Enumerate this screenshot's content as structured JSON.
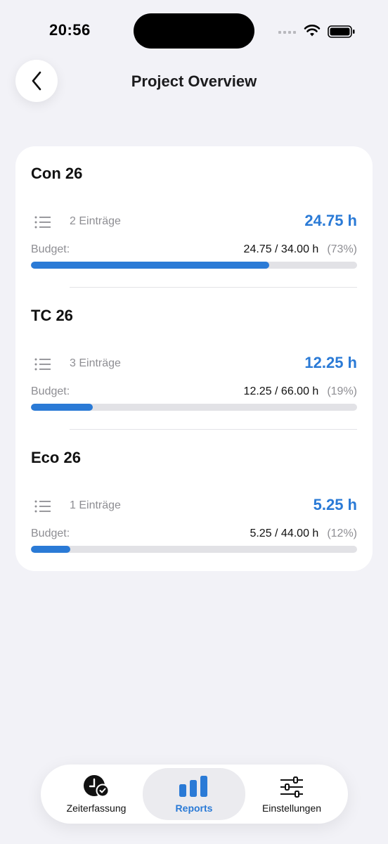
{
  "status": {
    "time": "20:56"
  },
  "header": {
    "title": "Project Overview",
    "back_icon": "chevron-left-icon"
  },
  "colors": {
    "accent": "#2a7ad6",
    "background": "#f2f2f7",
    "track": "#e2e2e6"
  },
  "projects": [
    {
      "name": "Con 26",
      "entries": "2 Einträge",
      "hours": "24.75 h",
      "budget_label": "Budget:",
      "budget": "24.75 / 34.00 h",
      "percent": "(73%)",
      "fill_percent": 73
    },
    {
      "name": "TC 26",
      "entries": "3 Einträge",
      "hours": "12.25 h",
      "budget_label": "Budget:",
      "budget": "12.25 / 66.00 h",
      "percent": "(19%)",
      "fill_percent": 19
    },
    {
      "name": "Eco 26",
      "entries": "1 Einträge",
      "hours": "5.25 h",
      "budget_label": "Budget:",
      "budget": "5.25 / 44.00 h",
      "percent": "(12%)",
      "fill_percent": 12
    }
  ],
  "tabbar": {
    "tabs": [
      {
        "label": "Zeiterfassung",
        "icon": "clock-check-icon",
        "active": false
      },
      {
        "label": "Reports",
        "icon": "bar-chart-icon",
        "active": true
      },
      {
        "label": "Einstellungen",
        "icon": "sliders-icon",
        "active": false
      }
    ]
  }
}
